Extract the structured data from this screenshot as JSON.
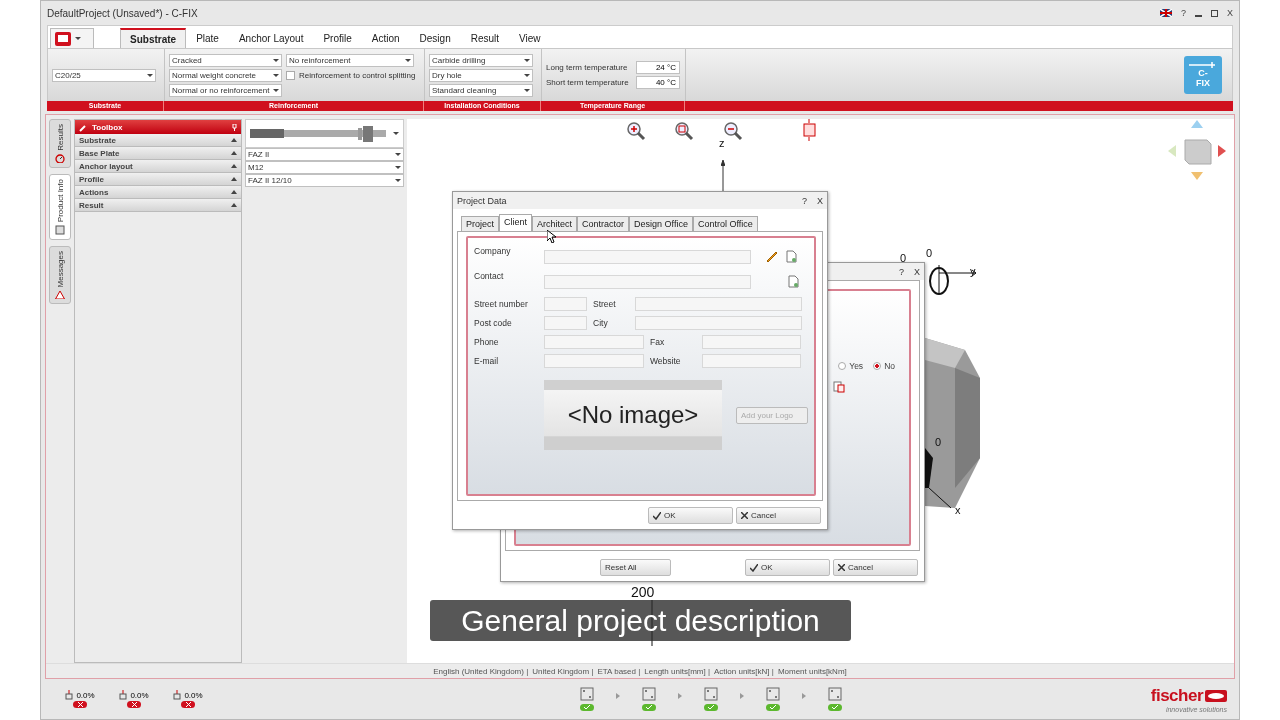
{
  "window": {
    "title": "DefaultProject (Unsaved*) - C-FIX",
    "help": "?",
    "close": "X"
  },
  "ribbon": {
    "tabs": [
      {
        "label": "Substrate",
        "selected": true
      },
      {
        "label": "Plate",
        "selected": false
      },
      {
        "label": "Anchor Layout",
        "selected": false
      },
      {
        "label": "Profile",
        "selected": false
      },
      {
        "label": "Action",
        "selected": false
      },
      {
        "label": "Design",
        "selected": false
      },
      {
        "label": "Result",
        "selected": false
      },
      {
        "label": "View",
        "selected": false
      }
    ],
    "substrate": "C20/25",
    "reinforcement": {
      "concrete": [
        "Cracked",
        "Normal weight concrete",
        "Normal or no reinforcement"
      ],
      "bars": "No reinforcement",
      "splitting": {
        "label": "Reinforcement to control splitting",
        "checked": false
      }
    },
    "installation": [
      "Carbide drilling",
      "Dry hole",
      "Standard cleaning"
    ],
    "temperature": [
      {
        "label": "Long term temperature",
        "value": "24 °C"
      },
      {
        "label": "Short term temperature",
        "value": "40 °C"
      }
    ],
    "groups": [
      "Substrate",
      "Reinforcement",
      "Installation Conditions",
      "Temperature Range"
    ],
    "product_button": [
      "C-",
      "FIX"
    ]
  },
  "side_tabs": [
    {
      "label": "Results",
      "selected": false,
      "kind": "results"
    },
    {
      "label": "Product Info",
      "selected": true,
      "kind": "info"
    },
    {
      "label": "Messages",
      "selected": false,
      "kind": "messages"
    }
  ],
  "toolbox": {
    "title": "Toolbox",
    "sections": [
      "Substrate",
      "Base Plate",
      "Anchor layout",
      "Profile",
      "Actions",
      "Result"
    ]
  },
  "product": {
    "selectors": [
      "FAZ II",
      "M12",
      "FAZ II 12/10"
    ]
  },
  "canvas": {
    "z_label": "z",
    "y_label": "y",
    "x_label": "x",
    "origin_labels": [
      "0",
      "0",
      "0"
    ],
    "dimension": "200"
  },
  "back_dialog": {
    "help": "?",
    "close": "X",
    "radios": [
      {
        "label": "Yes",
        "selected": false
      },
      {
        "label": "No",
        "selected": true
      }
    ],
    "reset": "Reset All",
    "ok": "OK",
    "cancel": "Cancel"
  },
  "project_dialog": {
    "title": "Project Data",
    "help": "?",
    "close": "X",
    "tabs": [
      {
        "label": "Project",
        "selected": false
      },
      {
        "label": "Client",
        "selected": true
      },
      {
        "label": "Architect",
        "selected": false
      },
      {
        "label": "Contractor",
        "selected": false
      },
      {
        "label": "Design Office",
        "selected": false
      },
      {
        "label": "Control Office",
        "selected": false
      }
    ],
    "rows": [
      {
        "kind": "wide",
        "label": "Company",
        "edit": true
      },
      {
        "kind": "wide",
        "label": "Contact",
        "edit": false
      },
      {
        "kind": "short",
        "label": "Street number",
        "label2": "Street"
      },
      {
        "kind": "short",
        "label": "Post code",
        "label2": "City"
      },
      {
        "kind": "half",
        "label": "Phone",
        "label2": "Fax"
      },
      {
        "kind": "half",
        "label": "E-mail",
        "label2": "Website"
      }
    ],
    "image": "<No image>",
    "logo_button": "Add your Logo",
    "ok": "OK",
    "cancel": "Cancel"
  },
  "caption": "General project description",
  "status": [
    "English (United Kingdom) |",
    "United Kingdom |",
    "ETA based |",
    "Length units[mm] |",
    "Action units[kN] |",
    "Moment units[kNm]"
  ],
  "utilization": [
    "0.0%",
    "0.0%",
    "0.0%"
  ],
  "steps": [
    {
      "ok": true
    },
    {
      "ok": true
    },
    {
      "ok": true
    },
    {
      "ok": true
    },
    {
      "ok": true
    }
  ],
  "brand": {
    "name": "fischer",
    "tagline": "innovative solutions"
  }
}
